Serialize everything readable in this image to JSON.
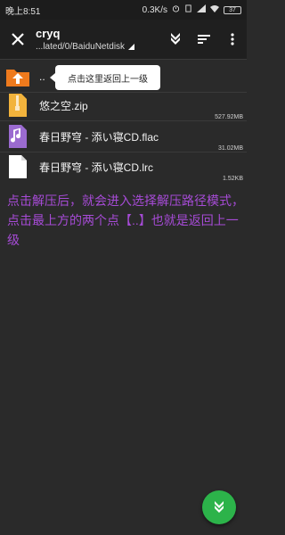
{
  "status_bar": {
    "time": "晚上8:51",
    "network_speed": "0.3K/s",
    "battery": "37"
  },
  "toolbar": {
    "title": "cryq",
    "path": "...lated/0/BaiduNetdisk"
  },
  "tooltip": {
    "text": "点击这里返回上一级"
  },
  "files": [
    {
      "name": "..",
      "size": "",
      "icon": "parent-folder-icon"
    },
    {
      "name": "悠之空.zip",
      "size": "527.92MB",
      "icon": "zip-file-icon"
    },
    {
      "name": "春日野穹 - 添い寝CD.flac",
      "size": "31.02MB",
      "icon": "audio-file-icon"
    },
    {
      "name": "春日野穹 - 添い寝CD.lrc",
      "size": "1.52KB",
      "icon": "text-file-icon"
    }
  ],
  "annotation": {
    "text": "点击解压后，就会进入选择解压路径模式，点击最上方的两个点【..】也就是返回上一级"
  },
  "colors": {
    "accent_orange": "#ee7a1d",
    "zip_yellow": "#f2b33c",
    "audio_purple": "#9b6bd0",
    "annotation_purple": "#a64bd6",
    "fab_green": "#2cb34a"
  }
}
